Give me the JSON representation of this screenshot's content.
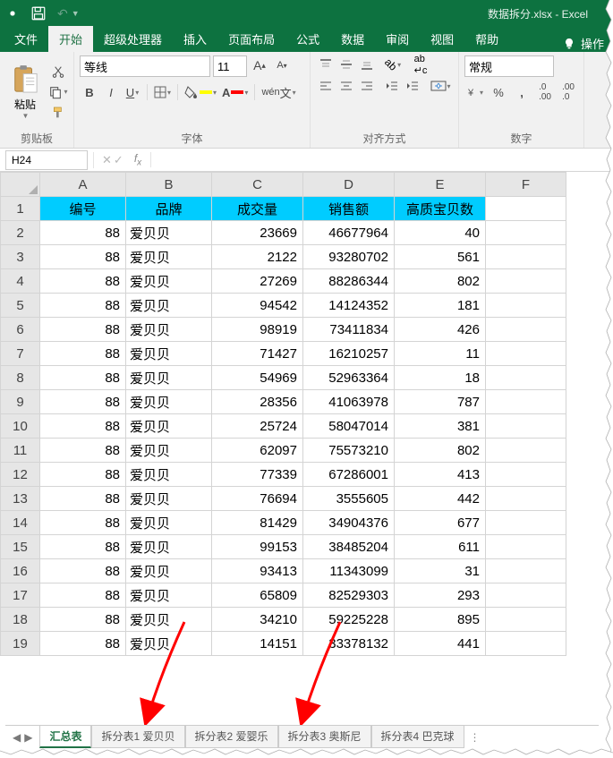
{
  "title": "数据拆分.xlsx - Excel",
  "tabs": [
    "文件",
    "开始",
    "超级处理器",
    "插入",
    "页面布局",
    "公式",
    "数据",
    "审阅",
    "视图",
    "帮助"
  ],
  "active_tab": 1,
  "tell_me": "操作",
  "clipboard": {
    "paste": "粘贴",
    "label": "剪贴板"
  },
  "font": {
    "name": "等线",
    "size": "11",
    "label": "字体"
  },
  "align": {
    "label": "对齐方式"
  },
  "number": {
    "format": "常规",
    "label": "数字"
  },
  "namebox": "H24",
  "columns": [
    "A",
    "B",
    "C",
    "D",
    "E",
    "F"
  ],
  "headers": [
    "编号",
    "品牌",
    "成交量",
    "销售额",
    "高质宝贝数"
  ],
  "rows": [
    {
      "r": 1
    },
    {
      "r": 2,
      "a": 88,
      "b": "爱贝贝",
      "c": 23669,
      "d": 46677964,
      "e": 40
    },
    {
      "r": 3,
      "a": 88,
      "b": "爱贝贝",
      "c": 2122,
      "d": 93280702,
      "e": 561
    },
    {
      "r": 4,
      "a": 88,
      "b": "爱贝贝",
      "c": 27269,
      "d": 88286344,
      "e": 802
    },
    {
      "r": 5,
      "a": 88,
      "b": "爱贝贝",
      "c": 94542,
      "d": 14124352,
      "e": 181
    },
    {
      "r": 6,
      "a": 88,
      "b": "爱贝贝",
      "c": 98919,
      "d": 73411834,
      "e": 426
    },
    {
      "r": 7,
      "a": 88,
      "b": "爱贝贝",
      "c": 71427,
      "d": 16210257,
      "e": 11
    },
    {
      "r": 8,
      "a": 88,
      "b": "爱贝贝",
      "c": 54969,
      "d": 52963364,
      "e": 18
    },
    {
      "r": 9,
      "a": 88,
      "b": "爱贝贝",
      "c": 28356,
      "d": 41063978,
      "e": 787
    },
    {
      "r": 10,
      "a": 88,
      "b": "爱贝贝",
      "c": 25724,
      "d": 58047014,
      "e": 381
    },
    {
      "r": 11,
      "a": 88,
      "b": "爱贝贝",
      "c": 62097,
      "d": 75573210,
      "e": 802
    },
    {
      "r": 12,
      "a": 88,
      "b": "爱贝贝",
      "c": 77339,
      "d": 67286001,
      "e": 413
    },
    {
      "r": 13,
      "a": 88,
      "b": "爱贝贝",
      "c": 76694,
      "d": 3555605,
      "e": 442
    },
    {
      "r": 14,
      "a": 88,
      "b": "爱贝贝",
      "c": 81429,
      "d": 34904376,
      "e": 677
    },
    {
      "r": 15,
      "a": 88,
      "b": "爱贝贝",
      "c": 99153,
      "d": 38485204,
      "e": 611
    },
    {
      "r": 16,
      "a": 88,
      "b": "爱贝贝",
      "c": 93413,
      "d": 11343099,
      "e": 31
    },
    {
      "r": 17,
      "a": 88,
      "b": "爱贝贝",
      "c": 65809,
      "d": 82529303,
      "e": 293
    },
    {
      "r": 18,
      "a": 88,
      "b": "爱贝贝",
      "c": 34210,
      "d": 59225228,
      "e": 895
    },
    {
      "r": 19,
      "a": 88,
      "b": "爱贝贝",
      "c": 14151,
      "d": 33378132,
      "e": 441
    }
  ],
  "sheets": [
    "汇总表",
    "拆分表1 爱贝贝",
    "拆分表2 爱婴乐",
    "拆分表3 奥斯尼",
    "拆分表4 巴克球"
  ],
  "active_sheet": 0,
  "chart_data": {
    "type": "table",
    "title": "数据拆分",
    "columns": [
      "编号",
      "品牌",
      "成交量",
      "销售额",
      "高质宝贝数"
    ],
    "data": [
      [
        88,
        "爱贝贝",
        23669,
        46677964,
        40
      ],
      [
        88,
        "爱贝贝",
        2122,
        93280702,
        561
      ],
      [
        88,
        "爱贝贝",
        27269,
        88286344,
        802
      ],
      [
        88,
        "爱贝贝",
        94542,
        14124352,
        181
      ],
      [
        88,
        "爱贝贝",
        98919,
        73411834,
        426
      ],
      [
        88,
        "爱贝贝",
        71427,
        16210257,
        11
      ],
      [
        88,
        "爱贝贝",
        54969,
        52963364,
        18
      ],
      [
        88,
        "爱贝贝",
        28356,
        41063978,
        787
      ],
      [
        88,
        "爱贝贝",
        25724,
        58047014,
        381
      ],
      [
        88,
        "爱贝贝",
        62097,
        75573210,
        802
      ],
      [
        88,
        "爱贝贝",
        77339,
        67286001,
        413
      ],
      [
        88,
        "爱贝贝",
        76694,
        3555605,
        442
      ],
      [
        88,
        "爱贝贝",
        81429,
        34904376,
        677
      ],
      [
        88,
        "爱贝贝",
        99153,
        38485204,
        611
      ],
      [
        88,
        "爱贝贝",
        93413,
        11343099,
        31
      ],
      [
        88,
        "爱贝贝",
        65809,
        82529303,
        293
      ],
      [
        88,
        "爱贝贝",
        34210,
        59225228,
        895
      ],
      [
        88,
        "爱贝贝",
        14151,
        33378132,
        441
      ]
    ]
  }
}
